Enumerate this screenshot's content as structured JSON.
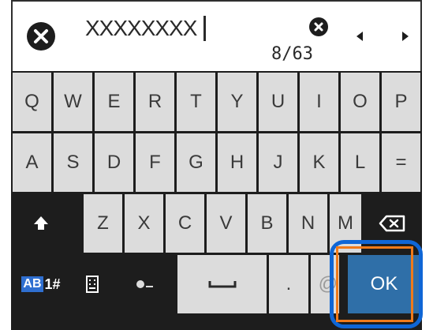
{
  "input": {
    "value": "XXXXXXXX",
    "counter": "8/63",
    "close_icon": "close-icon",
    "clear_icon": "clear-text-icon",
    "left_arrow_icon": "chevron-left-icon",
    "right_arrow_icon": "chevron-right-icon"
  },
  "keyboard": {
    "row1": [
      "Q",
      "W",
      "E",
      "R",
      "T",
      "Y",
      "U",
      "I",
      "O",
      "P"
    ],
    "row2": [
      "A",
      "S",
      "D",
      "F",
      "G",
      "H",
      "J",
      "K",
      "L",
      "="
    ],
    "row3": [
      "Z",
      "X",
      "C",
      "V",
      "B",
      "N",
      "M"
    ],
    "mode_label_box": "AB",
    "mode_label_rest": "1#",
    "ok_label": "OK",
    "shift_icon": "shift-icon",
    "backspace_icon": "backspace-icon",
    "layout_icon": "keyboard-layout-icon",
    "at_icon": "at-domain-icon",
    "space_icon": "space-icon",
    "period": ".",
    "at_partial": "@"
  },
  "colors": {
    "key_bg": "#dcdcdc",
    "dark_bg": "#1d1d1d",
    "ok_bg": "#2f6fa8",
    "highlight_blue": "#0f66d6",
    "highlight_orange": "#f07a1a"
  }
}
